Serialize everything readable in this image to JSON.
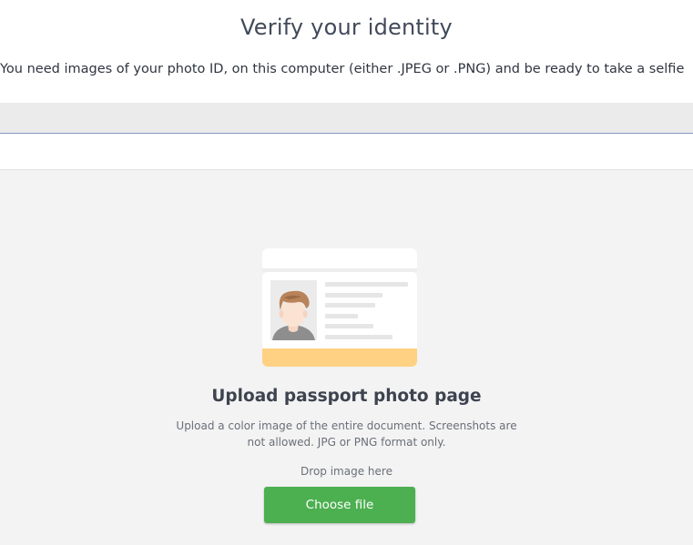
{
  "header": {
    "title": "Verify your identity",
    "subtitle": "You need images of your photo ID, on this computer (either .JPEG or .PNG) and be ready to take a selfie"
  },
  "upload": {
    "heading": "Upload passport photo page",
    "description": "Upload a color image of the entire document. Screenshots are not allowed. JPG or PNG format only.",
    "drop_label": "Drop image here",
    "button_label": "Choose file"
  },
  "colors": {
    "accent_button": "#4caf50",
    "card_stripe": "#ffd183",
    "upload_background": "#f3f3f3"
  },
  "icons": {
    "illustration": "passport-id-card-icon"
  }
}
